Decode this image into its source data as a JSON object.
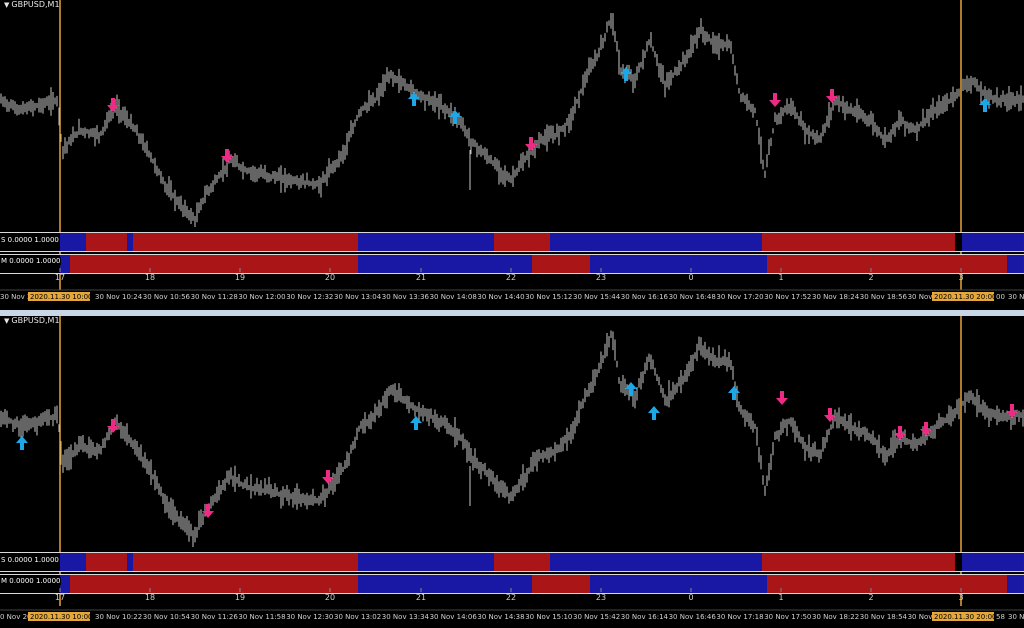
{
  "panels": [
    {
      "title": "GBPUSD,M1",
      "indicator_s_label": "S 0.0000 1.0000",
      "indicator_m_label": "M 0.0000 1.0000",
      "hour_labels": [
        "17",
        "18",
        "19",
        "20",
        "21",
        "22",
        "23",
        "0",
        "1",
        "2",
        "3"
      ],
      "time_labels": [
        "30 Nov 20",
        "30 Nov 10:24",
        "30 Nov 10:56",
        "30 Nov 11:28",
        "30 Nov 12:00",
        "30 Nov 12:32",
        "30 Nov 13:04",
        "30 Nov 13:36",
        "30 Nov 14:08",
        "30 Nov 14:40",
        "30 Nov 15:12",
        "30 Nov 15:44",
        "30 Nov 16:16",
        "30 Nov 16:48",
        "30 Nov 17:20",
        "30 Nov 17:52",
        "30 Nov 18:24",
        "30 Nov 18:56",
        "30 Nov 19:28",
        "30 Nov"
      ],
      "marker_left": "2020.11.30 10:00",
      "marker_right": "2020.11.30 20:00",
      "marker_right_tail": "00",
      "edge_right": "30 N"
    },
    {
      "title": "GBPUSD,M1",
      "indicator_s_label": "S 0.0000 1.0000",
      "indicator_m_label": "M 0.0000 1.0000",
      "hour_labels": [
        "17",
        "18",
        "19",
        "20",
        "21",
        "22",
        "23",
        "0",
        "1",
        "2",
        "3"
      ],
      "time_labels": [
        "0 Nov 20",
        "30 Nov 10:22",
        "30 Nov 10:54",
        "30 Nov 11:26",
        "30 Nov 11:58",
        "30 Nov 12:30",
        "30 Nov 13:02",
        "30 Nov 13:34",
        "30 Nov 14:06",
        "30 Nov 14:38",
        "30 Nov 15:10",
        "30 Nov 15:42",
        "30 Nov 16:14",
        "30 Nov 16:46",
        "30 Nov 17:18",
        "30 Nov 17:50",
        "30 Nov 18:22",
        "30 Nov 18:54",
        "30 Nov 19:26",
        "30 Nov"
      ],
      "marker_left": "2020.11.30 10:00",
      "marker_right": "2020.11.30 20:00",
      "marker_right_tail": "58",
      "edge_right": "30 N"
    }
  ],
  "colors": {
    "candle": "#c8c8c8",
    "up_arrow": "#1ea7e6",
    "down_arrow": "#ee2a84",
    "bar_red": "#b5181a",
    "bar_blue": "#1a1ab0",
    "vline": "#e5a63a",
    "marker_bg": "#e5a63a"
  },
  "signals": {
    "top": {
      "up": 5,
      "down": 5
    },
    "bottom": {
      "up": 5,
      "down": 8
    }
  }
}
